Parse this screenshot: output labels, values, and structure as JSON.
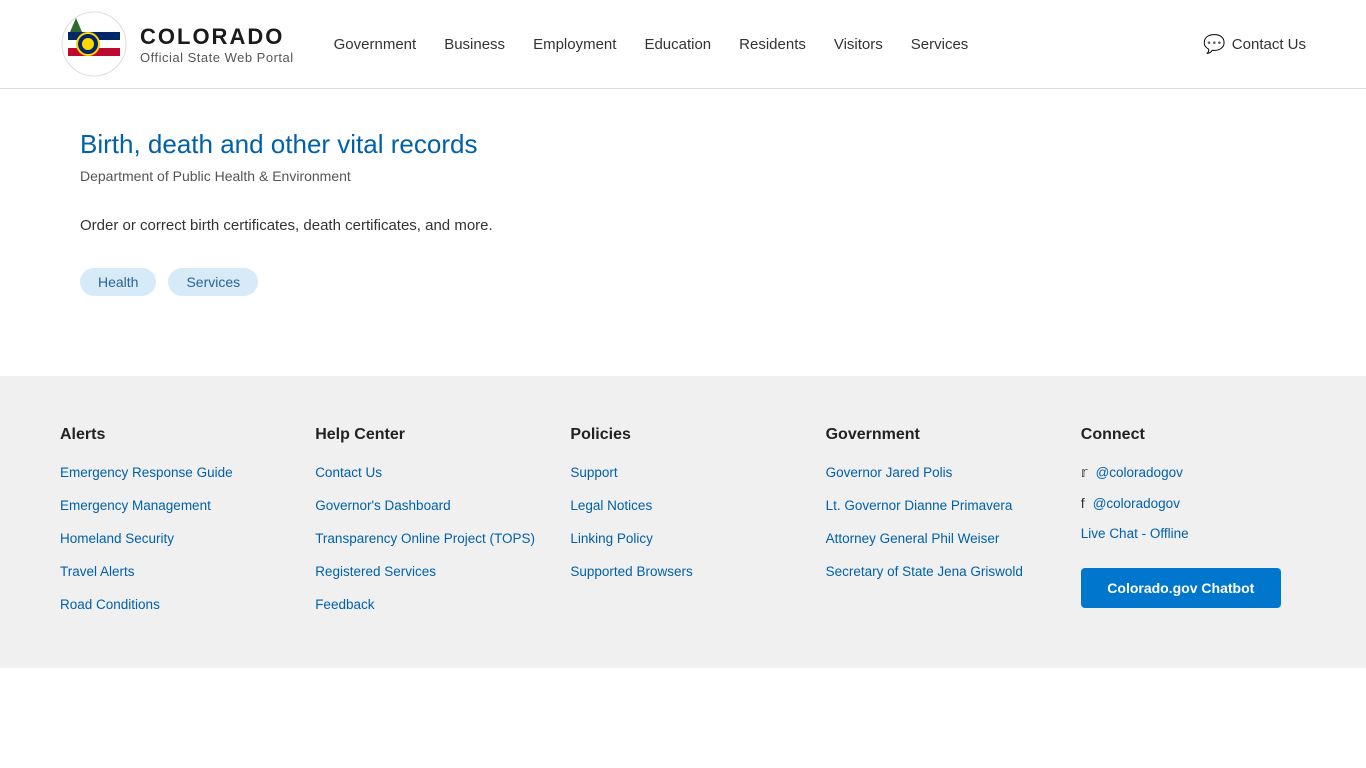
{
  "header": {
    "logo_title": "COLORADO",
    "logo_subtitle": "Official State Web Portal",
    "nav": [
      {
        "label": "Government",
        "href": "#"
      },
      {
        "label": "Business",
        "href": "#"
      },
      {
        "label": "Employment",
        "href": "#"
      },
      {
        "label": "Education",
        "href": "#"
      },
      {
        "label": "Residents",
        "href": "#"
      },
      {
        "label": "Visitors",
        "href": "#"
      },
      {
        "label": "Services",
        "href": "#"
      }
    ],
    "contact_us": "Contact Us"
  },
  "main": {
    "title": "Birth, death and other vital records",
    "department": "Department of Public Health & Environment",
    "description": "Order or correct birth certificates, death certificates, and more.",
    "tags": [
      "Health",
      "Services"
    ]
  },
  "footer": {
    "columns": [
      {
        "title": "Alerts",
        "links": [
          "Emergency Response Guide",
          "Emergency Management",
          "Homeland Security",
          "Travel Alerts",
          "Road Conditions"
        ]
      },
      {
        "title": "Help Center",
        "links": [
          "Contact Us",
          "Governor's Dashboard",
          "Transparency Online Project (TOPS)",
          "Registered Services",
          "Feedback"
        ]
      },
      {
        "title": "Policies",
        "links": [
          "Support",
          "Legal Notices",
          "Linking Policy",
          "Supported Browsers"
        ]
      },
      {
        "title": "Government",
        "links": [
          "Governor Jared Polis",
          "Lt. Governor Dianne Primavera",
          "Attorney General Phil Weiser",
          "Secretary of State Jena Griswold"
        ]
      },
      {
        "title": "Connect",
        "social": [
          {
            "icon": "twitter",
            "label": "@coloradogov"
          },
          {
            "icon": "facebook",
            "label": "@coloradogov"
          }
        ],
        "chat_label": "Live Chat - Offline",
        "chatbot_label": "Colorado.gov Chatbot"
      }
    ]
  }
}
